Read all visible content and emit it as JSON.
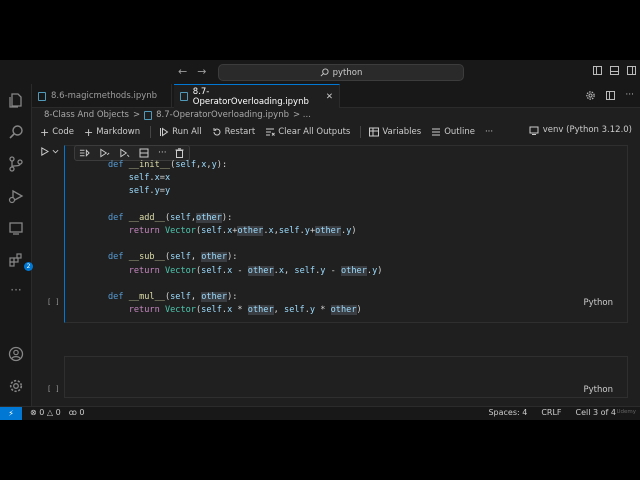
{
  "titlebar": {
    "back_glyph": "←",
    "forward_glyph": "→",
    "search_text": "python"
  },
  "tabs": [
    {
      "label": "8.6-magicmethods.ipynb",
      "active": false
    },
    {
      "label": "8.7-OperatorOverloading.ipynb",
      "active": true,
      "close": "✕"
    }
  ],
  "breadcrumb": {
    "folder": "8-Class And Objects",
    "sep": ">",
    "file": "8.7-OperatorOverloading.ipynb",
    "more": "> ..."
  },
  "toolbar": {
    "code": "Code",
    "markdown": "Markdown",
    "run_all": "Run All",
    "restart": "Restart",
    "clear_outputs": "Clear All Outputs",
    "variables": "Variables",
    "outline": "Outline",
    "more": "···",
    "kernel": "venv (Python 3.12.0)"
  },
  "cells": [
    {
      "exec": "[ ]",
      "lang": "Python"
    },
    {
      "exec": "[ ]",
      "lang": "Python"
    }
  ],
  "activity": {
    "badge": "2"
  },
  "status": {
    "remote": "⚡",
    "errors": "0",
    "warnings": "0",
    "ports": "0",
    "spaces": "Spaces: 4",
    "eol": "CRLF",
    "cell": "Cell 3 of 4",
    "watermark": "Udemy"
  },
  "colors": {
    "accent": "#0078d4",
    "background": "#1f1f1f"
  }
}
